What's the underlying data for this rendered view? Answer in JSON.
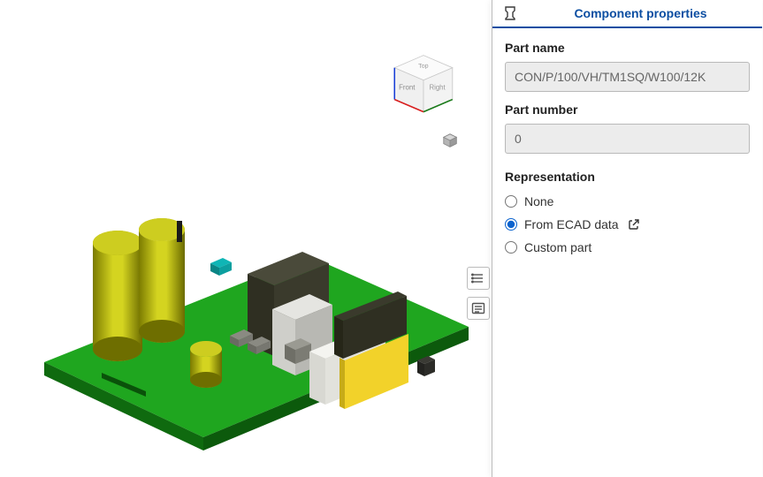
{
  "panel": {
    "tab_title": "Component properties",
    "part_name_label": "Part name",
    "part_name_value": "CON/P/100/VH/TM1SQ/W100/12K",
    "part_number_label": "Part number",
    "part_number_value": "0",
    "representation_label": "Representation",
    "options": {
      "none": "None",
      "ecad": "From ECAD data",
      "custom": "Custom part"
    },
    "selected": "ecad"
  },
  "nav_cube": {
    "top": "Top",
    "front": "Front",
    "right": "Right"
  }
}
